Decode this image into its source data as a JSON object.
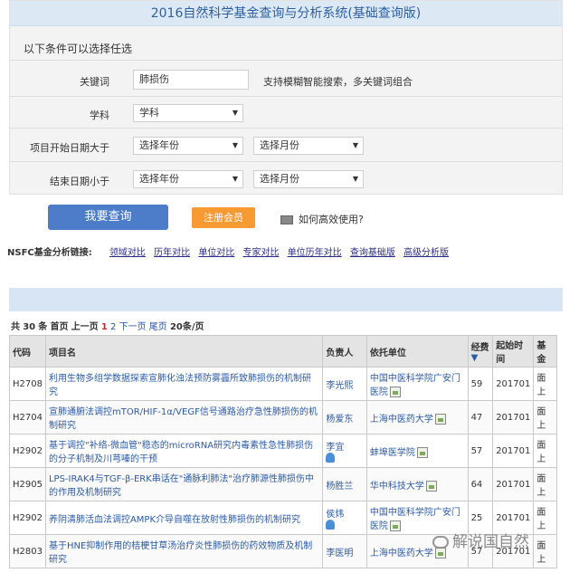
{
  "header": {
    "title": "2016自然科学基金查询与分析系统(基础查询版)"
  },
  "form": {
    "hint": "以下条件可以选择任选",
    "keyword_label": "关键词",
    "keyword_value": "肺损伤",
    "keyword_support": "支持模糊智能搜索，多关键词组合",
    "subject_label": "学科",
    "subject_value": "学科",
    "start_label": "项目开始日期大于",
    "end_label": "结束日期小于",
    "year_placeholder": "选择年份",
    "month_placeholder": "选择月份"
  },
  "actions": {
    "query_label": "我要查询",
    "member_label": "注册会员",
    "help_label": "如何高效使用?"
  },
  "nsfc": {
    "label": "NSFC基金分析链接:",
    "links": [
      "领域对比",
      "历年对比",
      "单位对比",
      "专家对比",
      "单位历年对比",
      "查询基础版",
      "高级分析版"
    ]
  },
  "pager": {
    "total_prefix": "共",
    "total": "30",
    "total_suffix": "条",
    "first": "首页",
    "prev": "上一页",
    "page1": "1",
    "page2": "2",
    "next": "下一页",
    "last": "尾页",
    "per_page": "20条/页"
  },
  "table": {
    "headers": {
      "code": "代码",
      "name": "项目名",
      "person": "负责人",
      "unit": "依托单位",
      "fund": "经费",
      "fund_arrow": "▼",
      "start": "起始时间",
      "type": "基金"
    },
    "rows": [
      {
        "code": "H2708",
        "name": "利用生物多组学数据探索宣肺化浊法预防雾霾所致肺损伤的机制研究",
        "person": "李光熙",
        "unit": "中国中医科学院广安门医院",
        "fund": "59",
        "start": "201701",
        "type": "面上"
      },
      {
        "code": "H2704",
        "name": "宣肺通腑法调控mTOR/HIF-1α/VEGF信号通路治疗急性肺损伤的机制研究",
        "person": "杨爱东",
        "unit": "上海中医药大学",
        "fund": "47",
        "start": "201701",
        "type": "面上"
      },
      {
        "code": "H2902",
        "name": "基于调控\"补络-微血管\"稳态的microRNA研究内毒素性急性肺损伤的分子机制及川芎嗪的干预",
        "person": "李宜",
        "unit": "蚌埠医学院",
        "fund": "57",
        "start": "201701",
        "type": "面上"
      },
      {
        "code": "H2905",
        "name": "LPS-IRAK4与TGF-β-ERK串话在\"通脉利肺法\"治疗肺源性肺损伤中的作用及机制研究",
        "person": "杨胜兰",
        "unit": "华中科技大学",
        "fund": "64",
        "start": "201701",
        "type": "面上"
      },
      {
        "code": "H2902",
        "name": "养阴清肺活血法调控AMPK介导自噬在放射性肺损伤的机制研究",
        "person": "侯炜",
        "unit": "中国中医科学院广安门医院",
        "fund": "25",
        "start": "201701",
        "type": "面上"
      },
      {
        "code": "H2803",
        "name": "基于HNE抑制作用的桔梗甘草汤治疗炎性肺损伤的药效物质及机制研究",
        "person": "李医明",
        "unit": "上海中医药大学",
        "fund": "57",
        "start": "201701",
        "type": "面上"
      }
    ]
  },
  "watermark": {
    "text": "解说国自然"
  }
}
